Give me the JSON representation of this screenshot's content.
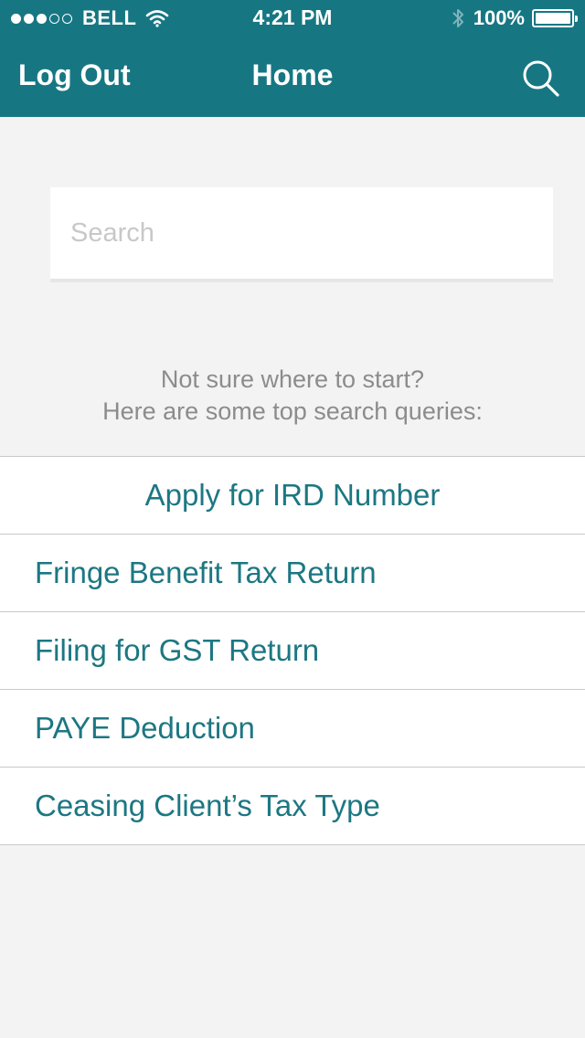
{
  "status_bar": {
    "carrier": "BELL",
    "time": "4:21 PM",
    "battery": "100%",
    "signal_bars_filled": 3,
    "signal_bars_total": 5
  },
  "nav": {
    "left_label": "Log Out",
    "title": "Home",
    "search_icon": "search-icon"
  },
  "search": {
    "placeholder": "Search",
    "value": ""
  },
  "hint": {
    "line1": "Not sure where to start?",
    "line2": "Here are some top search queries:"
  },
  "queries": [
    {
      "label": "Apply for IRD Number"
    },
    {
      "label": "Fringe Benefit Tax Return"
    },
    {
      "label": "Filing for GST Return"
    },
    {
      "label": "PAYE Deduction"
    },
    {
      "label": "Ceasing Client’s Tax Type"
    }
  ],
  "colors": {
    "header": "#167783",
    "accent_text": "#1d7782",
    "background": "#f3f3f3"
  }
}
